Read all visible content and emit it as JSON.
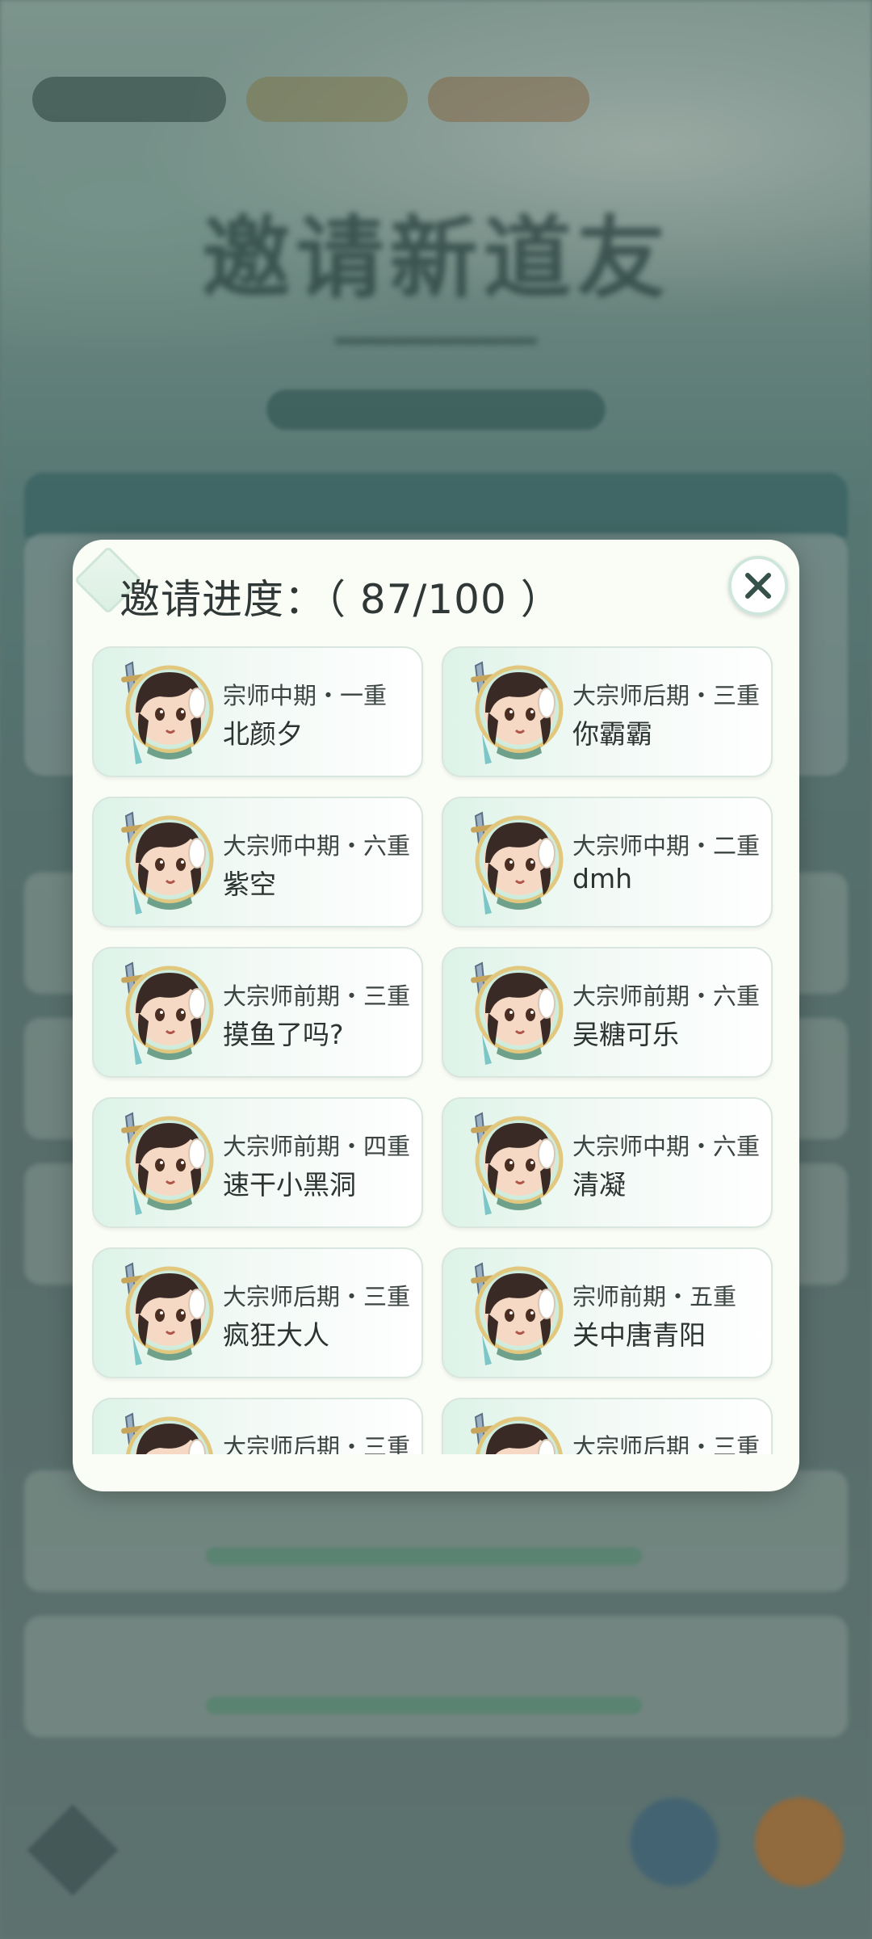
{
  "dialog": {
    "title_label": "邀请进度：",
    "progress": "（ 87/100 ）",
    "progress_value": 87,
    "progress_total": 100,
    "close_icon": "close-icon"
  },
  "invitees": [
    {
      "rank": "宗师中期・一重",
      "name": "北颜夕"
    },
    {
      "rank": "大宗师后期・三重",
      "name": "你霸霸"
    },
    {
      "rank": "大宗师中期・六重",
      "name": "紫空"
    },
    {
      "rank": "大宗师中期・二重",
      "name": "dmh"
    },
    {
      "rank": "大宗师前期・三重",
      "name": "摸鱼了吗?"
    },
    {
      "rank": "大宗师前期・六重",
      "name": "吴糖可乐"
    },
    {
      "rank": "大宗师前期・四重",
      "name": "速干小黑洞"
    },
    {
      "rank": "大宗师中期・六重",
      "name": "清凝"
    },
    {
      "rank": "大宗师后期・三重",
      "name": "疯狂大人"
    },
    {
      "rank": "宗师前期・五重",
      "name": "关中唐青阳"
    },
    {
      "rank": "大宗师后期・三重",
      "name": ""
    },
    {
      "rank": "大宗师后期・三重",
      "name": ""
    }
  ],
  "colors": {
    "modal_bg": "#fafdf6",
    "card_accent": "#ddf3e8",
    "text_dark": "#2f3836"
  }
}
